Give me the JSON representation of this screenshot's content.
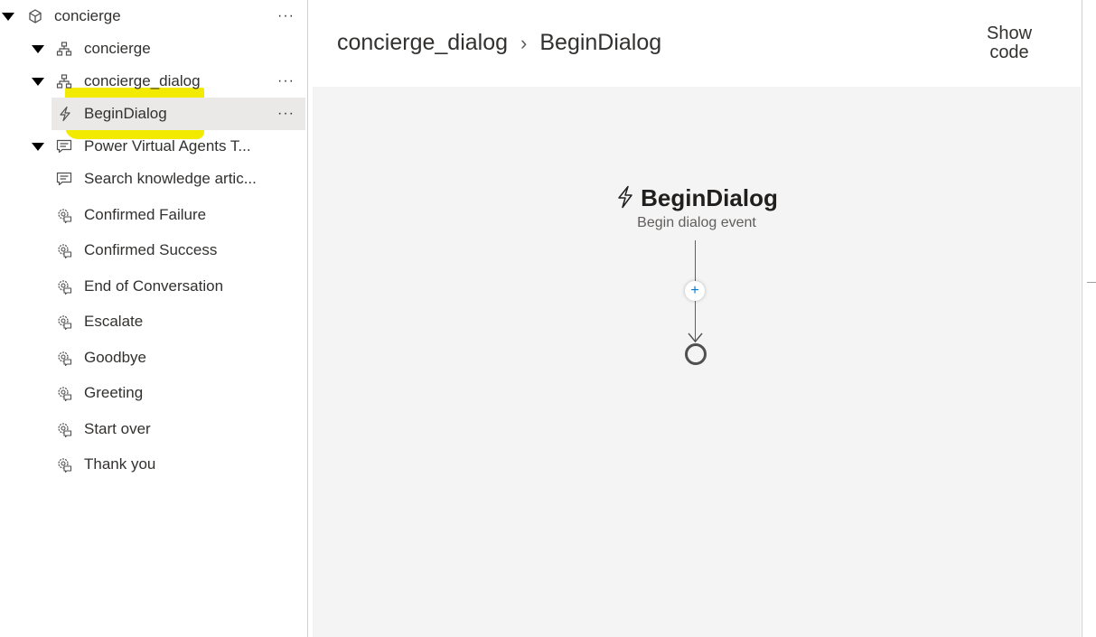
{
  "tree": {
    "root": {
      "label": "concierge",
      "more": "···"
    },
    "items": [
      {
        "label": "concierge",
        "more": ""
      },
      {
        "label": "concierge_dialog",
        "more": "···"
      },
      {
        "label": "BeginDialog",
        "more": "···"
      },
      {
        "label": "Power Virtual Agents T...",
        "more": ""
      },
      {
        "label": "Search knowledge artic...",
        "more": ""
      },
      {
        "label": "Confirmed Failure",
        "more": ""
      },
      {
        "label": "Confirmed Success",
        "more": ""
      },
      {
        "label": "End of Conversation",
        "more": ""
      },
      {
        "label": "Escalate",
        "more": ""
      },
      {
        "label": "Goodbye",
        "more": ""
      },
      {
        "label": "Greeting",
        "more": ""
      },
      {
        "label": "Start over",
        "more": ""
      },
      {
        "label": "Thank you",
        "more": ""
      }
    ]
  },
  "header": {
    "breadcrumb": [
      "concierge_dialog",
      "BeginDialog"
    ],
    "separator": "›",
    "show_code_line1": "Show",
    "show_code_line2": "code"
  },
  "canvas": {
    "node_title": "BeginDialog",
    "node_subtitle": "Begin dialog event",
    "add_label": "+"
  },
  "colors": {
    "highlight": "#f2ea00",
    "selected_row": "#ebe9e8",
    "canvas_bg": "#f4f4f4",
    "accent": "#0078d4"
  }
}
